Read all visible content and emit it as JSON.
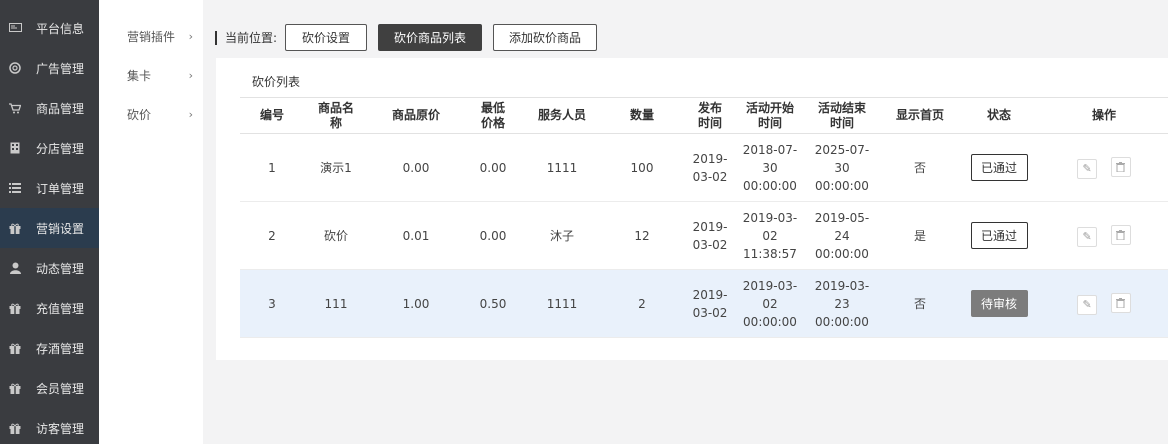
{
  "sidebar": {
    "items": [
      {
        "label": "平台信息",
        "icon": "monitor-icon",
        "active": false
      },
      {
        "label": "广告管理",
        "icon": "target-icon",
        "active": false
      },
      {
        "label": "商品管理",
        "icon": "cart-icon",
        "active": false
      },
      {
        "label": "分店管理",
        "icon": "store-icon",
        "active": false
      },
      {
        "label": "订单管理",
        "icon": "list-icon",
        "active": false
      },
      {
        "label": "营销设置",
        "icon": "gift-icon",
        "active": true
      },
      {
        "label": "动态管理",
        "icon": "user-icon",
        "active": false
      },
      {
        "label": "充值管理",
        "icon": "gift-icon",
        "active": false
      },
      {
        "label": "存酒管理",
        "icon": "gift-icon",
        "active": false
      },
      {
        "label": "会员管理",
        "icon": "gift-icon",
        "active": false
      },
      {
        "label": "访客管理",
        "icon": "gift-icon",
        "active": false
      }
    ]
  },
  "submenu": {
    "items": [
      {
        "label": "营销插件"
      },
      {
        "label": "集卡"
      },
      {
        "label": "砍价"
      }
    ]
  },
  "breadcrumb": {
    "label": "当前位置:",
    "buttons": [
      "砍价设置",
      "砍价商品列表",
      "添加砍价商品"
    ]
  },
  "panel": {
    "title": "砍价列表"
  },
  "table": {
    "headers": [
      "编号",
      "商品名称",
      "商品原价",
      "最低价格",
      "服务人员",
      "数量",
      "发布时间",
      "活动开始时间",
      "活动结束时间",
      "显示首页",
      "状态",
      "操作"
    ],
    "rows": [
      {
        "id": "1",
        "name": "演示1",
        "orig_price": "0.00",
        "min_price": "0.00",
        "staff": "1111",
        "qty": "100",
        "publish_time": "2019-03-02",
        "start_time": "2018-07-30 00:00:00",
        "end_time": "2025-07-30 00:00:00",
        "show_home": "否",
        "status": "已通过",
        "status_type": "approved"
      },
      {
        "id": "2",
        "name": "砍价",
        "orig_price": "0.01",
        "min_price": "0.00",
        "staff": "沐子",
        "qty": "12",
        "publish_time": "2019-03-02",
        "start_time": "2019-03-02 11:38:57",
        "end_time": "2019-05-24 00:00:00",
        "show_home": "是",
        "status": "已通过",
        "status_type": "approved"
      },
      {
        "id": "3",
        "name": "111",
        "orig_price": "1.00",
        "min_price": "0.50",
        "staff": "1111",
        "qty": "2",
        "publish_time": "2019-03-02",
        "start_time": "2019-03-02 00:00:00",
        "end_time": "2019-03-23 00:00:00",
        "show_home": "否",
        "status": "待审核",
        "status_type": "pending"
      }
    ]
  },
  "colors": {
    "sidebar_bg": "#3a3c40",
    "sidebar_active": "#2b3c4e",
    "highlight_row": "#e9f1fb",
    "pending_badge": "#7c7c7c"
  }
}
